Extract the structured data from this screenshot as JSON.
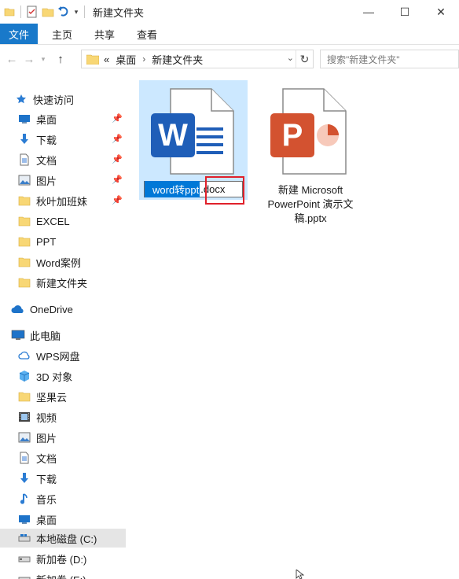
{
  "window": {
    "title": "新建文件夹",
    "controls": {
      "minimize": "—",
      "maximize": "☐",
      "close": "✕"
    }
  },
  "ribbon": {
    "tabs": [
      {
        "label": "文件"
      },
      {
        "label": "主页"
      },
      {
        "label": "共享"
      },
      {
        "label": "查看"
      }
    ]
  },
  "address": {
    "overflow": "«",
    "parts": [
      "桌面",
      "新建文件夹"
    ],
    "search_placeholder": "搜索\"新建文件夹\""
  },
  "sidebar": {
    "quick_access": {
      "label": "快速访问",
      "items": [
        {
          "label": "桌面",
          "icon": "desktop-icon",
          "pinned": true
        },
        {
          "label": "下载",
          "icon": "download-arrow-icon",
          "pinned": true
        },
        {
          "label": "文档",
          "icon": "document-icon",
          "pinned": true
        },
        {
          "label": "图片",
          "icon": "picture-icon",
          "pinned": true
        },
        {
          "label": "秋叶加班妹",
          "icon": "folder-icon",
          "pinned": true
        },
        {
          "label": "EXCEL",
          "icon": "folder-icon",
          "pinned": false
        },
        {
          "label": "PPT",
          "icon": "folder-icon",
          "pinned": false
        },
        {
          "label": "Word案例",
          "icon": "folder-icon",
          "pinned": false
        },
        {
          "label": "新建文件夹",
          "icon": "folder-icon",
          "pinned": false
        }
      ]
    },
    "onedrive": {
      "label": "OneDrive"
    },
    "this_pc": {
      "label": "此电脑",
      "items": [
        {
          "label": "WPS网盘",
          "icon": "cloud-icon"
        },
        {
          "label": "3D 对象",
          "icon": "cube-icon"
        },
        {
          "label": "坚果云",
          "icon": "folder-icon"
        },
        {
          "label": "视频",
          "icon": "video-icon"
        },
        {
          "label": "图片",
          "icon": "picture-icon"
        },
        {
          "label": "文档",
          "icon": "document-icon"
        },
        {
          "label": "下载",
          "icon": "download-arrow-icon"
        },
        {
          "label": "音乐",
          "icon": "music-note-icon"
        },
        {
          "label": "桌面",
          "icon": "desktop-icon"
        },
        {
          "label": "本地磁盘 (C:)",
          "icon": "drive-icon",
          "selected": true
        },
        {
          "label": "新加卷 (D:)",
          "icon": "drive-icon"
        },
        {
          "label": "新加卷 (E:)",
          "icon": "drive-icon"
        }
      ]
    }
  },
  "files": [
    {
      "type": "word",
      "app_letter": "W",
      "rename_selected": "word转ppt",
      "rename_rest": ".docx",
      "selected": true
    },
    {
      "type": "powerpoint",
      "app_letter": "P",
      "name_line1": "新建 Microsoft",
      "name_line2": "PowerPoint 演示文",
      "name_line3": "稿.pptx",
      "selected": false
    }
  ],
  "colors": {
    "accent": "#1979ca",
    "word_blue": "#1f5eb8",
    "ppt_orange": "#d35230",
    "selection": "#cce8ff",
    "highlight_box": "#e0202a",
    "folder": "#f8d775"
  }
}
